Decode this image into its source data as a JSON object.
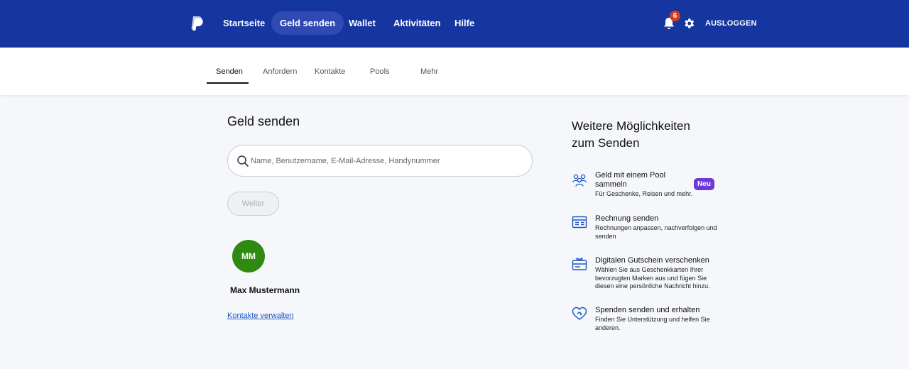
{
  "colors": {
    "nav_bg": "#1535a0",
    "nav_active": "#2f4bb3",
    "badge": "#d93b1c",
    "avatar": "#2e8a11",
    "neu_badge": "#6c3bd6",
    "link": "#1a56c4"
  },
  "topnav": {
    "logo_icon": "paypal-logo",
    "items": [
      "Startseite",
      "Geld senden",
      "Wallet",
      "Aktivitäten",
      "Hilfe"
    ],
    "active": "Geld senden",
    "notification_count": "6",
    "logout_label": "AUSLOGGEN"
  },
  "subnav": {
    "items": [
      "Senden",
      "Anfordern",
      "Kontakte",
      "Pools",
      "Mehr"
    ],
    "active": "Senden"
  },
  "main": {
    "title": "Geld senden",
    "search_placeholder": "Name, Benutzername, E-Mail-Adresse, Handynummer",
    "search_value": "",
    "continue_label": "Weiter",
    "contact": {
      "initials": "MM",
      "name": "Max Mustermann"
    },
    "manage_contacts_label": "Kontakte verwalten"
  },
  "side": {
    "title": "Weitere Möglichkeiten zum Senden",
    "options": [
      {
        "icon": "group-icon",
        "title": "Geld mit einem Pool sammeln",
        "badge": "Neu",
        "desc": "Für Geschenke, Reisen und mehr."
      },
      {
        "icon": "invoice-icon",
        "title": "Rechnung senden",
        "desc": "Rechnungen anpassen, nachverfolgen und senden"
      },
      {
        "icon": "gift-card-icon",
        "title": "Digitalen Gutschein verschenken",
        "desc": "Wählen Sie aus Geschenkkarten Ihrer bevorzugten Marken aus und fügen Sie diesen eine persönliche Nachricht hinzu."
      },
      {
        "icon": "heart-hand-icon",
        "title": "Spenden senden und erhalten",
        "desc": "Finden Sie Unterstützung und helfen Sie anderen."
      }
    ]
  }
}
